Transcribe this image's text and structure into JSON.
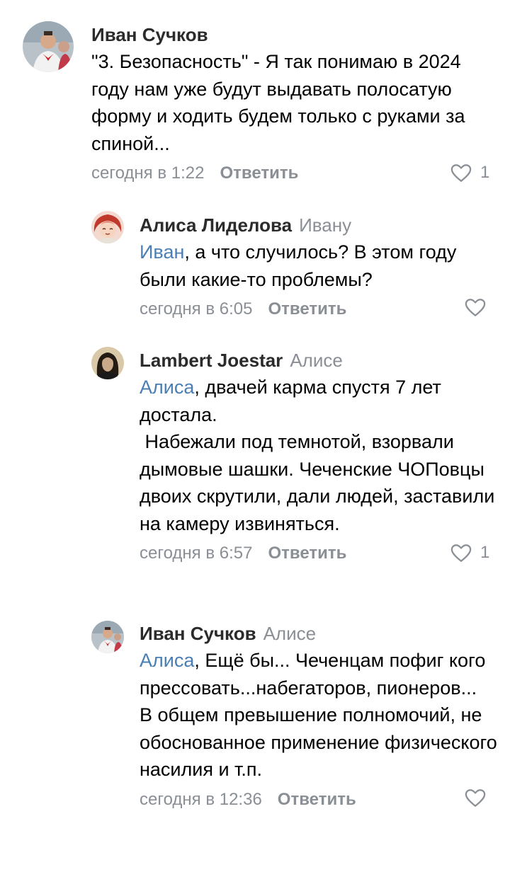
{
  "comments": [
    {
      "author": "Иван Сучков",
      "reply_to": "",
      "mention": "",
      "text": "\"3. Безопасность\" - Я так понимаю в 2024 году нам уже будут выдавать полосатую форму и ходить будем только с руками за спиной...",
      "time": "сегодня в 1:22",
      "reply_label": "Ответить",
      "likes": "1",
      "avatar": "photo-avatar"
    },
    {
      "author": "Алиса Лиделова",
      "reply_to": "Ивану",
      "mention": "Иван",
      "text": ", а что случилось? В этом году были какие-то проблемы?",
      "time": "сегодня в 6:05",
      "reply_label": "Ответить",
      "likes": "",
      "avatar": "anime-avatar"
    },
    {
      "author": "Lambert Joestar",
      "reply_to": "Алисе",
      "mention": "Алиса",
      "text": ", двачей карма спустя 7 лет достала.\n Набежали под темнотой, взорвали дымовые шашки. Чеченские ЧОПовцы двоих скрутили, дали людей, заставили на камеру извиняться.",
      "time": "сегодня в 6:57",
      "reply_label": "Ответить",
      "likes": "1",
      "avatar": "portrait-avatar"
    },
    {
      "author": "Иван Сучков",
      "reply_to": "Алисе",
      "mention": "Алиса",
      "text": ", Ещё бы... Чеченцам пофиг кого прессовать...набегаторов, пионеров...\nВ общем превышение полномочий, не обоснованное применение физического насилия и т.п.",
      "time": "сегодня в 12:36",
      "reply_label": "Ответить",
      "likes": "",
      "avatar": "photo-avatar"
    }
  ],
  "colors": {
    "link": "#4a7fb5",
    "muted": "#8a8f96",
    "author": "#2b2b2b"
  }
}
